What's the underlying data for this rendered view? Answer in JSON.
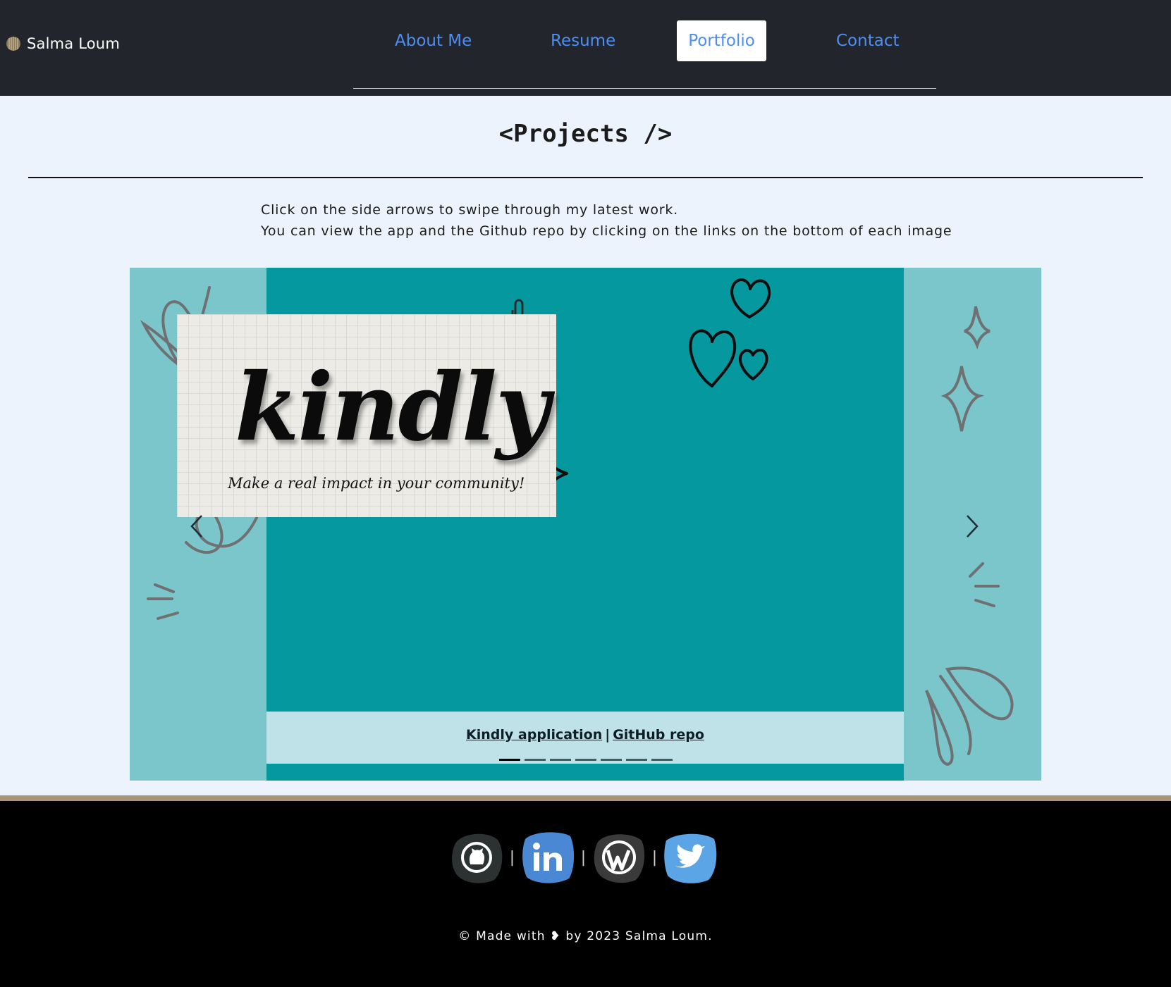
{
  "brand": {
    "name": "Salma Loum"
  },
  "nav": {
    "items": [
      {
        "label": "About Me"
      },
      {
        "label": "Resume"
      },
      {
        "label": "Portfolio",
        "active": true
      },
      {
        "label": "Contact"
      }
    ]
  },
  "main": {
    "title": "<Projects />",
    "intro_line1": "Click on the side arrows to swipe through my latest work.",
    "intro_line2": "You can view the app and the Github repo by clicking on the links on the bottom of each image"
  },
  "carousel": {
    "slide": {
      "image_title": "kindly",
      "image_tagline": "Make a real impact in your community!",
      "app_link": "Kindly application",
      "separator": "|",
      "repo_link": "GitHub repo"
    },
    "slide_count": 7,
    "active_index": 0,
    "prev_icon": "chevron-left-icon",
    "next_icon": "chevron-right-icon"
  },
  "footer": {
    "socials": [
      {
        "name": "github-icon"
      },
      {
        "name": "linkedin-icon"
      },
      {
        "name": "wordpress-icon"
      },
      {
        "name": "twitter-icon"
      }
    ],
    "separator": "|",
    "copyright": "© Made with ❥ by 2023 Salma Loum."
  },
  "colors": {
    "header_bg": "#22252b",
    "nav_link": "#4d8ef2",
    "page_bg": "#ecf3fd",
    "carousel_side": "#7bc6ca",
    "slide_bg": "#05999f",
    "caption_bg": "#bfe1e8",
    "footer_bg": "#000000",
    "footer_rule": "#a89478"
  }
}
